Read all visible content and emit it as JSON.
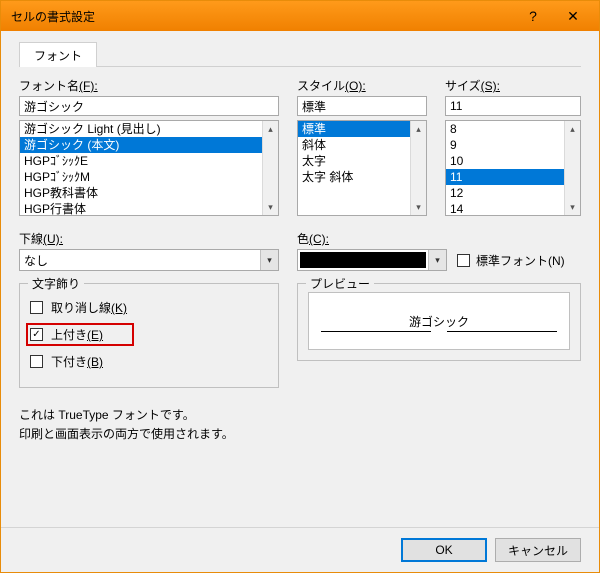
{
  "titlebar": {
    "title": "セルの書式設定"
  },
  "tabs": {
    "tab0": {
      "label": "フォント"
    }
  },
  "labels": {
    "font_name": "フォント名",
    "font_name_key": "(F):",
    "style": "スタイル",
    "style_key": "(O):",
    "size": "サイズ",
    "size_key": "(S):",
    "underline": "下線",
    "underline_key": "(U):",
    "color": "色",
    "color_key": "(C):",
    "normal_font": "標準フォント",
    "normal_font_key": "(N)",
    "deco_legend": "文字飾り",
    "preview_legend": "プレビュー",
    "strike": "取り消し線",
    "strike_key": "(K)",
    "super": "上付き",
    "super_key": "(E)",
    "sub": "下付き",
    "sub_key": "(B)"
  },
  "font": {
    "value": "游ゴシック",
    "items": [
      {
        "label": "游ゴシック Light (見出し)",
        "selected": false
      },
      {
        "label": "游ゴシック (本文)",
        "selected": true
      },
      {
        "label": "HGPｺﾞｼｯｸE",
        "selected": false
      },
      {
        "label": "HGPｺﾞｼｯｸM",
        "selected": false
      },
      {
        "label": "HGP教科書体",
        "selected": false
      },
      {
        "label": "HGP行書体",
        "selected": false
      }
    ]
  },
  "style": {
    "value": "標準",
    "items": [
      {
        "label": "標準",
        "selected": true
      },
      {
        "label": "斜体",
        "selected": false
      },
      {
        "label": "太字",
        "selected": false
      },
      {
        "label": "太字 斜体",
        "selected": false
      }
    ]
  },
  "size": {
    "value": "11",
    "items": [
      {
        "label": "8",
        "selected": false
      },
      {
        "label": "9",
        "selected": false
      },
      {
        "label": "10",
        "selected": false
      },
      {
        "label": "11",
        "selected": true
      },
      {
        "label": "12",
        "selected": false
      },
      {
        "label": "14",
        "selected": false
      }
    ]
  },
  "underline": {
    "value": "なし"
  },
  "color": {
    "value": "#000000"
  },
  "decorations": {
    "strike": false,
    "superscript": true,
    "subscript": false
  },
  "preview": {
    "sample": "游ゴシック"
  },
  "description": {
    "line1": "これは TrueType フォントです。",
    "line2": "印刷と画面表示の両方で使用されます。"
  },
  "buttons": {
    "ok": "OK",
    "cancel": "キャンセル"
  },
  "glyphs": {
    "check": "✓",
    "down": "▾",
    "up": "▴",
    "help": "?",
    "close": "✕"
  }
}
